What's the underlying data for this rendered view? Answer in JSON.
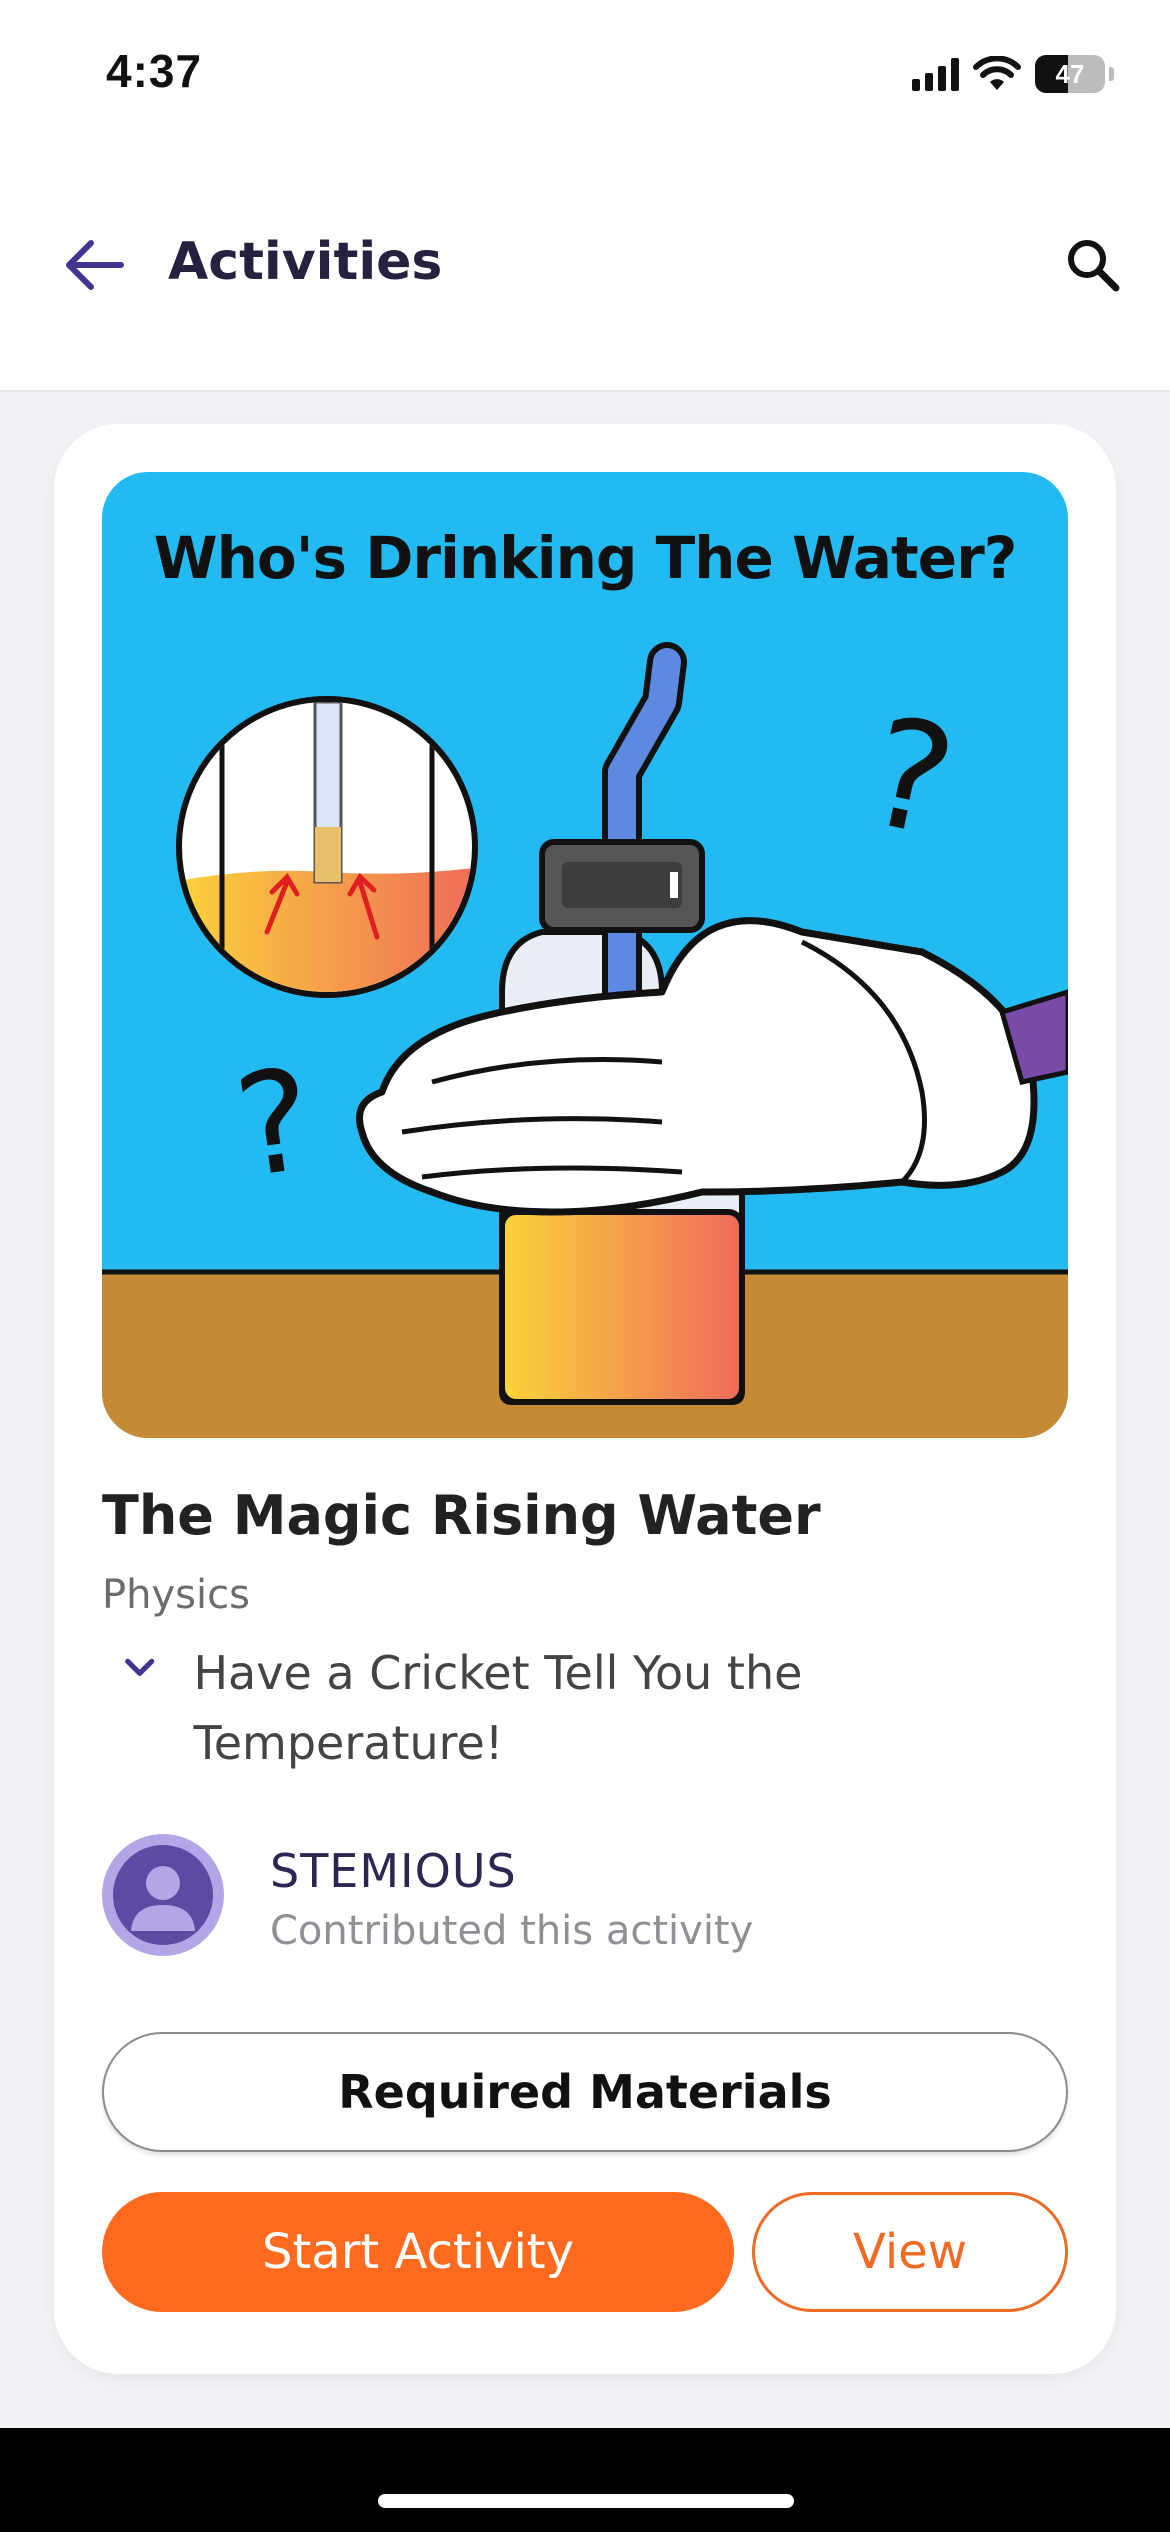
{
  "status_bar": {
    "time": "4:37",
    "battery": "47"
  },
  "header": {
    "title": "Activities"
  },
  "activity": {
    "image_caption": "Who's Drinking The Water?",
    "title": "The Magic Rising Water",
    "subject": "Physics",
    "description": "Have a Cricket Tell You the Temperature!",
    "contributor_name": "STEMIOUS",
    "contributor_sub": "Contributed this activity"
  },
  "actions": {
    "materials_label": "Required Materials",
    "start_label": "Start Activity",
    "view_label": "View"
  },
  "colors": {
    "accent_purple": "#3f3590",
    "primary_orange": "#ff6a1f",
    "hero_sky": "#22baf0",
    "hero_table": "#c48a36"
  },
  "icons": [
    "back-arrow-icon",
    "search-icon",
    "chevron-down-icon",
    "user-icon",
    "signal-icon",
    "wifi-icon",
    "battery-icon"
  ]
}
